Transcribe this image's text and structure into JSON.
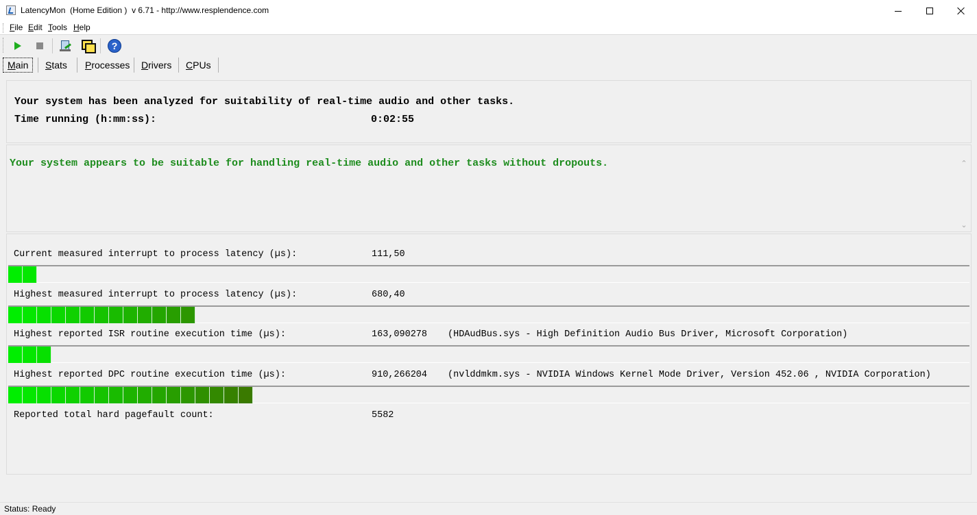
{
  "window": {
    "title": "LatencyMon  (Home Edition )  v 6.71 - http://www.resplendence.com",
    "minimize_icon": "minimize-icon",
    "maximize_icon": "maximize-icon",
    "close_icon": "close-icon"
  },
  "menu": {
    "items": [
      {
        "key": "F",
        "rest": "ile"
      },
      {
        "key": "E",
        "rest": "dit"
      },
      {
        "key": "T",
        "rest": "ools"
      },
      {
        "key": "H",
        "rest": "elp"
      }
    ]
  },
  "toolbar": {
    "buttons": [
      "play-icon",
      "stop-icon",
      "cpu-analyze-icon",
      "windows-icon",
      "help-icon"
    ],
    "help_glyph": "?"
  },
  "tabs": [
    {
      "key": "M",
      "rest": "ain",
      "active": true
    },
    {
      "key": "S",
      "rest": "tats",
      "active": false
    },
    {
      "key": "P",
      "rest": "rocesses",
      "active": false
    },
    {
      "key": "D",
      "rest": "rivers",
      "active": false
    },
    {
      "key": "C",
      "rest": "PUs",
      "active": false
    }
  ],
  "summary": {
    "analyzed_text": "Your system has been analyzed for suitability of real-time audio and other tasks.",
    "time_label": "Time running (h:mm:ss):",
    "time_value": "0:02:55"
  },
  "verdict": {
    "message": "Your system appears to be suitable for handling real-time audio and other tasks without dropouts.",
    "color": "#1d8c1d"
  },
  "metrics": [
    {
      "label": "Current measured interrupt to process latency (µs):",
      "value": "111,50",
      "driver": "",
      "bar_segments": 2
    },
    {
      "label": "Highest measured interrupt to process latency (µs):",
      "value": "680,40",
      "driver": "",
      "bar_segments": 13
    },
    {
      "label": "Highest reported ISR routine execution time (µs):",
      "value": "163,090278",
      "driver": "(HDAudBus.sys - High Definition Audio Bus Driver, Microsoft Corporation)",
      "bar_segments": 3
    },
    {
      "label": "Highest reported DPC routine execution time (µs):",
      "value": "910,266204",
      "driver": "(nvlddmkm.sys - NVIDIA Windows Kernel Mode Driver, Version 452.06 , NVIDIA Corporation)",
      "bar_segments": 17
    },
    {
      "label": "Reported total hard pagefault count:",
      "value": "5582",
      "driver": "",
      "bar_segments": 0
    }
  ],
  "bar_colors": {
    "start": "#00ee00",
    "end": "#3a7a00"
  },
  "status": {
    "text": "Status: Ready"
  }
}
